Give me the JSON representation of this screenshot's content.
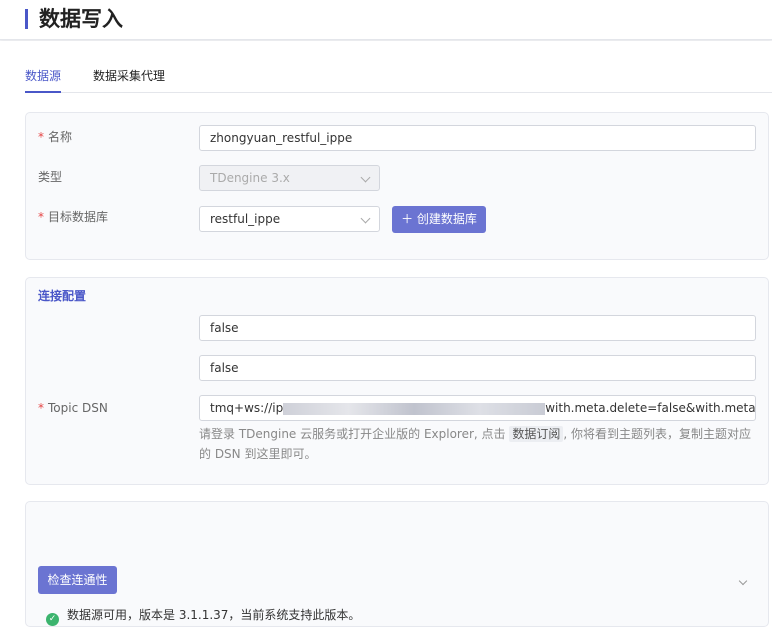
{
  "header": {
    "title": "数据写入"
  },
  "tabs": [
    {
      "label": "数据源",
      "active": true
    },
    {
      "label": "数据采集代理",
      "active": false
    }
  ],
  "form": {
    "name": {
      "label": "名称",
      "value": "zhongyuan_restful_ippe",
      "required": true
    },
    "type": {
      "label": "类型",
      "value": "TDengine 3.x",
      "disabled": true
    },
    "target_db": {
      "label": "目标数据库",
      "value": "restful_ippe",
      "required": true
    },
    "create_db_button": "＋ 创建数据库"
  },
  "connection": {
    "section_title": "连接配置",
    "field1_value": "false",
    "field2_value": "false",
    "topic_dsn": {
      "label": "Topic DSN",
      "required": true,
      "value_prefix": "tmq+ws://ip",
      "value_suffix": "with.meta.delete=false&with.meta.dro"
    },
    "hint_part1": "请登录 TDengine 云服务或打开企业版的 Explorer, 点击",
    "hint_code": "数据订阅",
    "hint_part2": ", 你将看到主题列表，复制主题对应的 DSN 到这里即可。"
  },
  "check": {
    "button_label": "检查连通性",
    "status_text": "数据源可用，版本是 3.1.1.37，当前系统支持此版本。"
  },
  "colors": {
    "accent": "#4a57c8",
    "primary_button": "#6b74d2",
    "success": "#3cb46e",
    "required": "#e54545"
  }
}
